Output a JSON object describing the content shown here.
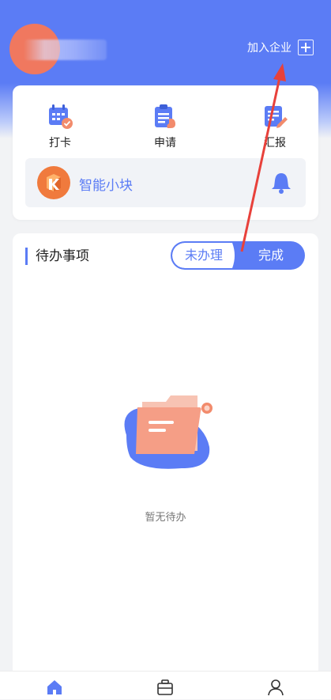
{
  "header": {
    "join_company_label": "加入企业"
  },
  "quick_actions": [
    {
      "label": "打卡",
      "icon": "calendar-check-icon"
    },
    {
      "label": "申请",
      "icon": "clipboard-hand-icon"
    },
    {
      "label": "汇报",
      "icon": "report-edit-icon"
    }
  ],
  "smart_block": {
    "title": "智能小块",
    "logo": "smart-block-logo",
    "notify_icon": "bell-icon"
  },
  "todo": {
    "title": "待办事项",
    "tab_pending": "未办理",
    "tab_done": "完成",
    "empty_text": "暂无待办"
  },
  "colors": {
    "primary": "#5b7cf5",
    "avatar": "#f0785f",
    "annotation_arrow": "#e8413b"
  }
}
